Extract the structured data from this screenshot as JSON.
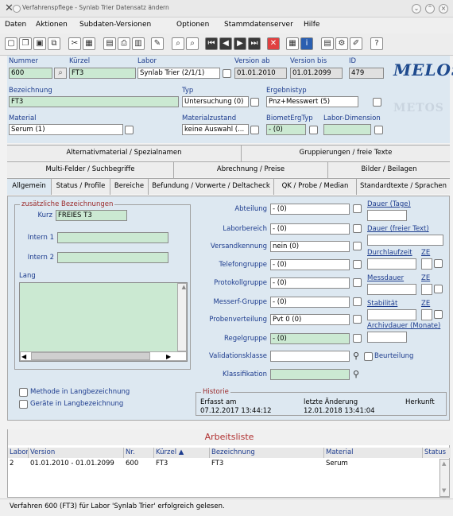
{
  "window": {
    "title": "Verfahrenspflege - Synlab Trier Datensatz ändern"
  },
  "menu": [
    "Daten",
    "Aktionen",
    "Subdaten-Versionen",
    "Optionen",
    "Stammdatenserver",
    "Hilfe"
  ],
  "header": {
    "nummer_label": "Nummer",
    "nummer": "600",
    "kuerzel_label": "Kürzel",
    "kuerzel": "FT3",
    "labor_label": "Labor",
    "labor": "Synlab Trier (2/1/1)",
    "version_ab_label": "Version ab",
    "version_ab": "01.01.2010",
    "version_bis_label": "Version bis",
    "version_bis": "01.01.2099",
    "id_label": "ID",
    "id": "479",
    "bezeichnung_label": "Bezeichnung",
    "bezeichnung": "FT3",
    "typ_label": "Typ",
    "typ": "Untersuchung (0)",
    "ergebnistyp_label": "Ergebnistyp",
    "ergebnistyp": "Pnz+Messwert (5)",
    "material_label": "Material",
    "material": "Serum (1)",
    "materialzustand_label": "Materialzustand",
    "materialzustand": "keine Auswahl (...",
    "biometergtyp_label": "BiometErgTyp",
    "biometergtyp": "- (0)",
    "labor_dimension_label": "Labor-Dimension",
    "labor_dimension": "",
    "logo": "MELOS",
    "logo_watermark": "METOS"
  },
  "tabs": {
    "row1": [
      "Alternativmaterial / Spezialnamen",
      "Gruppierungen / freie Texte"
    ],
    "row2": [
      "Multi-Felder / Suchbegriffe",
      "Abrechnung / Preise",
      "Bilder / Beilagen"
    ],
    "row3": [
      "Allgemein",
      "Status / Profile",
      "Bereiche",
      "Befundung / Vorwerte / Deltacheck",
      "QK / Probe / Median",
      "Standardtexte / Sprachen"
    ]
  },
  "allgemein": {
    "zus_group": "zusätzliche Bezeichnungen",
    "kurz_label": "Kurz",
    "kurz": "FREIES T3",
    "intern1_label": "Intern 1",
    "intern1": "",
    "intern2_label": "Intern 2",
    "intern2": "",
    "lang_label": "Lang",
    "lang": "",
    "methode_label": "Methode in Langbezeichnung",
    "geraete_label": "Geräte in Langbezeichnung",
    "abteilung_label": "Abteilung",
    "abteilung": "- (0)",
    "laborbereich_label": "Laborbereich",
    "laborbereich": "- (0)",
    "versandkennung_label": "Versandkennung",
    "versandkennung": "nein (0)",
    "telefongruppe_label": "Telefongruppe",
    "telefongruppe": "- (0)",
    "protokollgruppe_label": "Protokollgruppe",
    "protokollgruppe": "- (0)",
    "messerf_label": "Messerf-Gruppe",
    "messerf": "- (0)",
    "probenverteilung_label": "Probenverteilung",
    "probenverteilung": "Pvt 0 (0)",
    "regelgruppe_label": "Regelgruppe",
    "regelgruppe": "- (0)",
    "validationsklasse_label": "Validationsklasse",
    "validationsklasse": "",
    "klassifikation_label": "Klassifikation",
    "klassifikation": "",
    "beurteilung_label": "Beurteilung",
    "dauer_tage_label": "Dauer (Tage)",
    "dauer_freier_label": "Dauer (freier Text)",
    "durchlaufzeit_label": "Durchlaufzeit",
    "ze_label": "ZE",
    "messdauer_label": "Messdauer",
    "stabilitaet_label": "Stabilität",
    "archivdauer_label": "Archivdauer (Monate)",
    "historie_label": "Historie",
    "erfasst_label": "Erfasst am",
    "erfasst": "07.12.2017 13:44:12",
    "aenderung_label": "letzte Änderung",
    "aenderung": "12.01.2018 13:41:04",
    "herkunft_label": "Herkunft"
  },
  "worklist": {
    "title": "Arbeitsliste",
    "columns": [
      "Labor",
      "Version",
      "Nr.",
      "Kürzel ▲",
      "Bezeichnung",
      "Material",
      "Status"
    ],
    "rows": [
      [
        "2",
        "01.01.2010 - 01.01.2099",
        "600",
        "FT3",
        "FT3",
        "Serum",
        ""
      ]
    ]
  },
  "status": "Verfahren 600 (FT3) für Labor 'Synlab Trier' erfolgreich gelesen."
}
